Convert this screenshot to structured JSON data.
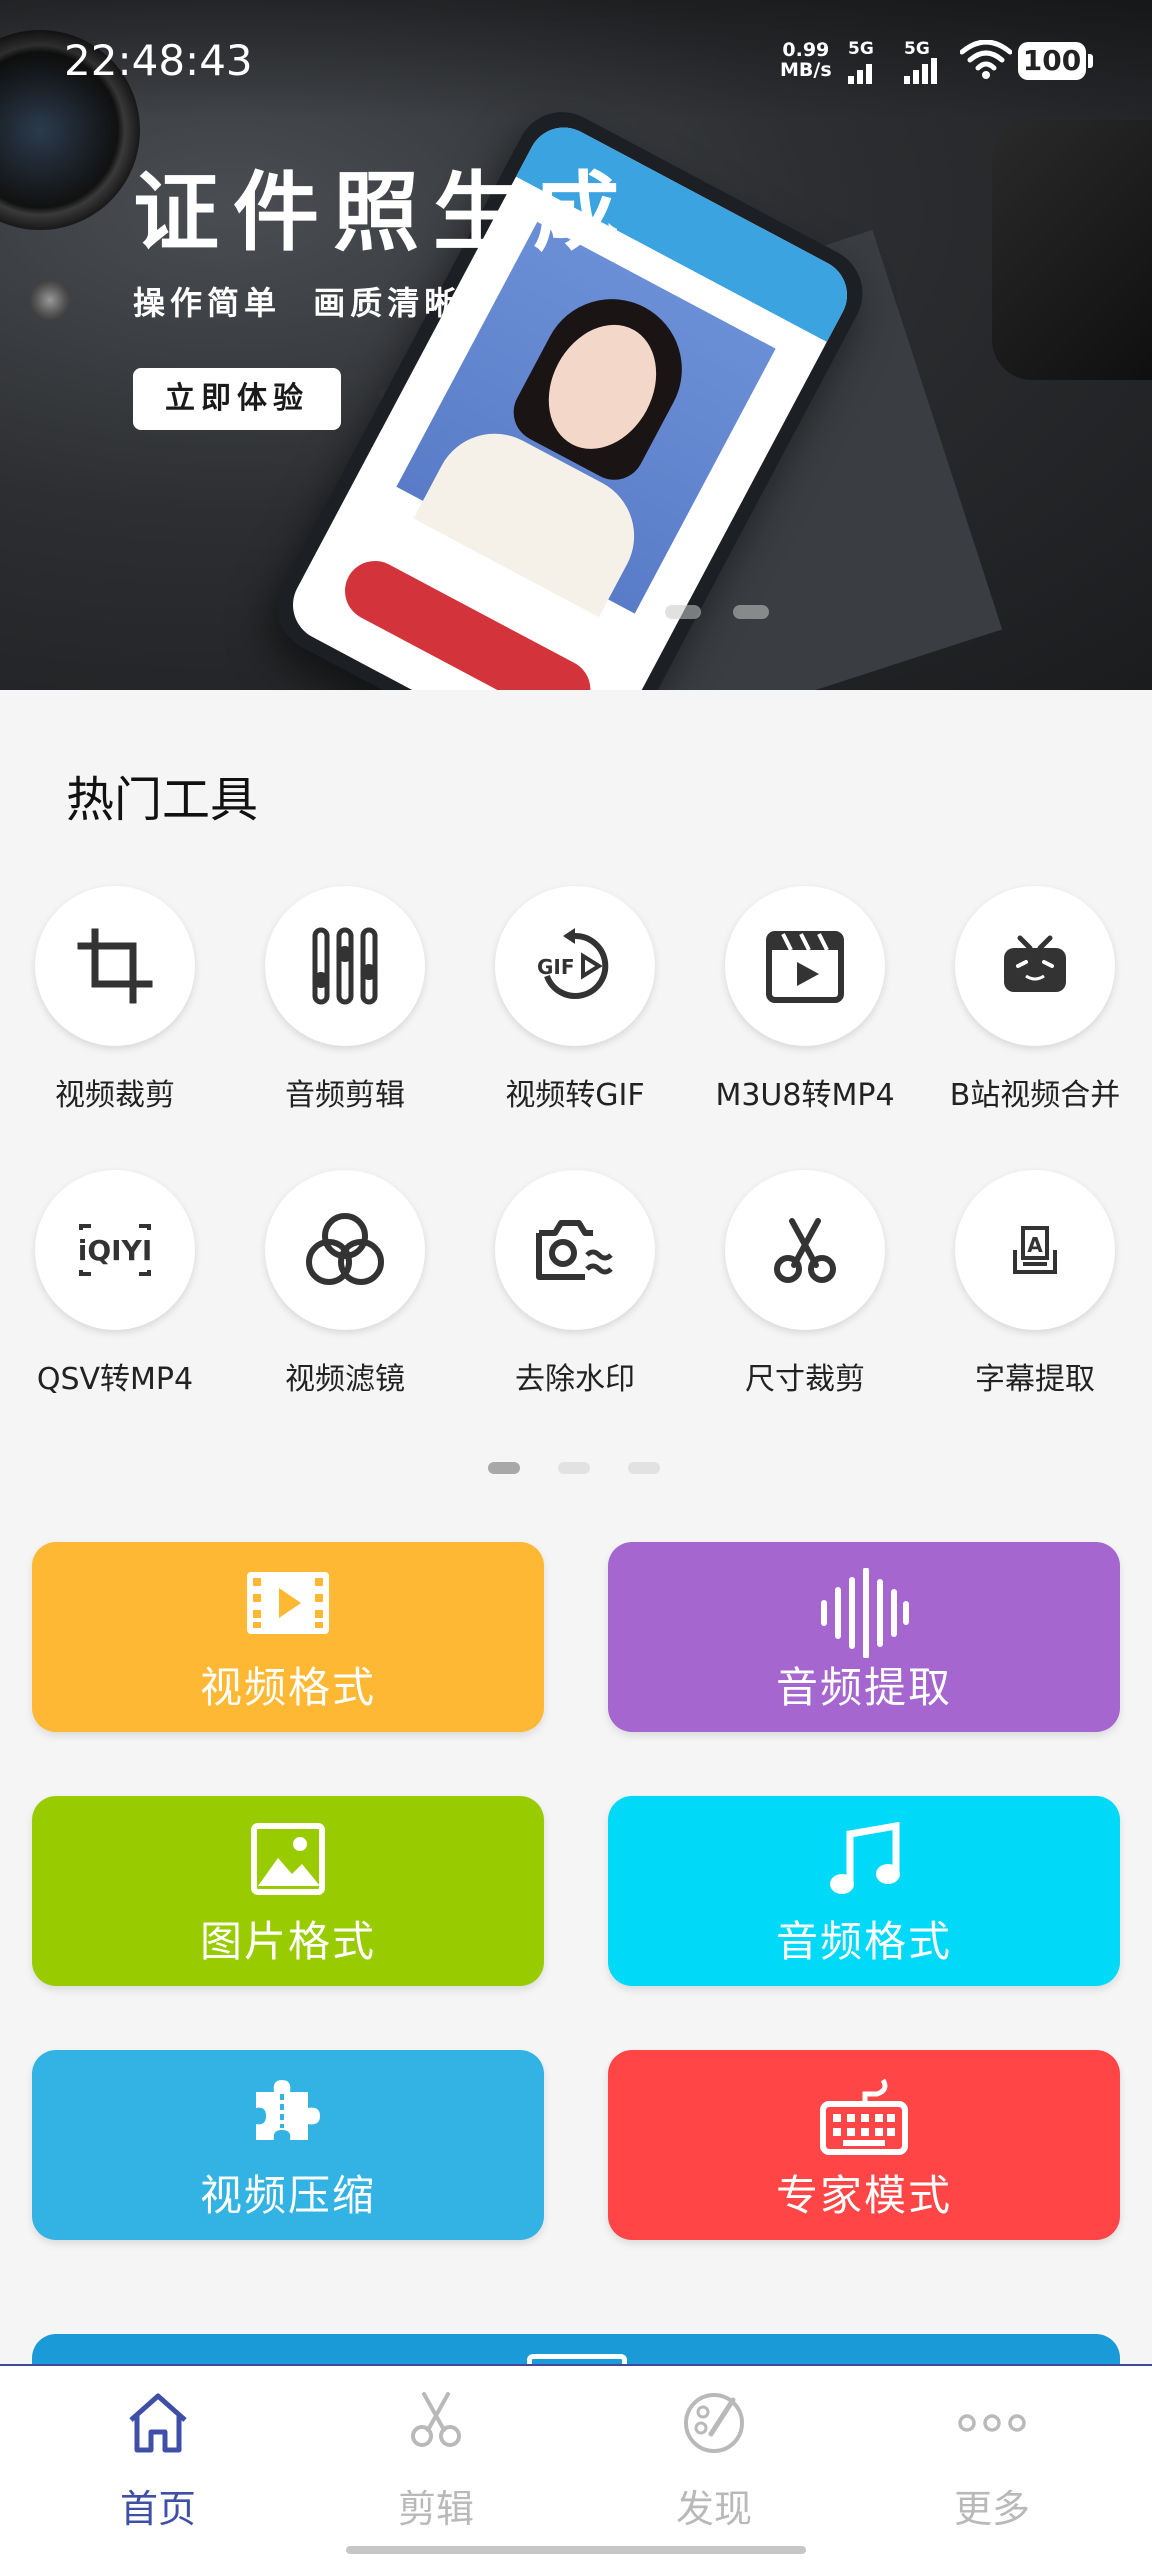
{
  "status": {
    "time": "22:48:43",
    "net_speed_value": "0.99",
    "net_speed_unit": "MB/s",
    "signal1_label": "5G",
    "signal2_label": "5G",
    "battery": "100"
  },
  "banner": {
    "title": "证件照生成",
    "subtitle": "操作简单  画质清晰",
    "cta": "立即体验",
    "page_count": 2,
    "active_page": 1
  },
  "hot_tools": {
    "title": "热门工具",
    "items": [
      {
        "label": "视频裁剪",
        "icon": "crop-icon"
      },
      {
        "label": "音频剪辑",
        "icon": "equalizer-icon"
      },
      {
        "label": "视频转GIF",
        "icon": "gif-replay-icon"
      },
      {
        "label": "M3U8转MP4",
        "icon": "video-clapper-icon"
      },
      {
        "label": "B站视频合并",
        "icon": "tv-icon"
      },
      {
        "label": "QSV转MP4",
        "icon": "iqiyi-logo-icon"
      },
      {
        "label": "视频滤镜",
        "icon": "filter-circles-icon"
      },
      {
        "label": "去除水印",
        "icon": "camera-watermark-icon"
      },
      {
        "label": "尺寸裁剪",
        "icon": "scissors-icon"
      },
      {
        "label": "字幕提取",
        "icon": "subtitle-icon"
      }
    ],
    "page_count": 3,
    "active_page": 1
  },
  "feature_cards": [
    {
      "label": "视频格式",
      "icon": "film-strip-icon",
      "color": "#FFB833"
    },
    {
      "label": "音频提取",
      "icon": "soundwave-icon",
      "color": "#A566D0"
    },
    {
      "label": "图片格式",
      "icon": "image-icon",
      "color": "#99CC00"
    },
    {
      "label": "音频格式",
      "icon": "music-note-icon",
      "color": "#00D9F7"
    },
    {
      "label": "视频压缩",
      "icon": "puzzle-icon",
      "color": "#33B2E4"
    },
    {
      "label": "专家模式",
      "icon": "keyboard-icon",
      "color": "#FF4545"
    }
  ],
  "bottom_nav": {
    "items": [
      {
        "label": "首页",
        "icon": "home-icon",
        "active": true
      },
      {
        "label": "剪辑",
        "icon": "scissors-icon",
        "active": false
      },
      {
        "label": "发现",
        "icon": "palette-icon",
        "active": false
      },
      {
        "label": "更多",
        "icon": "more-dots-icon",
        "active": false
      }
    ],
    "active_color": "#3F4FA8",
    "inactive_color": "#B9B9B9"
  }
}
